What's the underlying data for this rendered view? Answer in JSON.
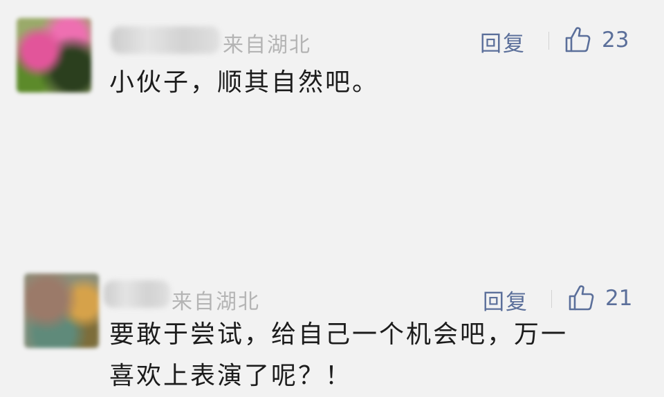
{
  "comments": [
    {
      "location": "来自湖北",
      "reply_label": "回复",
      "like_count": "23",
      "like_icon": "thumbs-up-outline",
      "text_lines": [
        "小伙子，顺其自然吧。"
      ]
    },
    {
      "location": "来自湖北",
      "reply_label": "回复",
      "like_count": "21",
      "like_icon": "thumbs-up-outline",
      "text_lines": [
        "要敢于尝试，给自己一个机会吧，万一",
        "喜欢上表演了呢？！"
      ]
    }
  ],
  "colors": {
    "background": "#f2f2f2",
    "accent": "#5b6f9a",
    "meta": "#b4b4b4",
    "text": "#1c1c1c"
  }
}
